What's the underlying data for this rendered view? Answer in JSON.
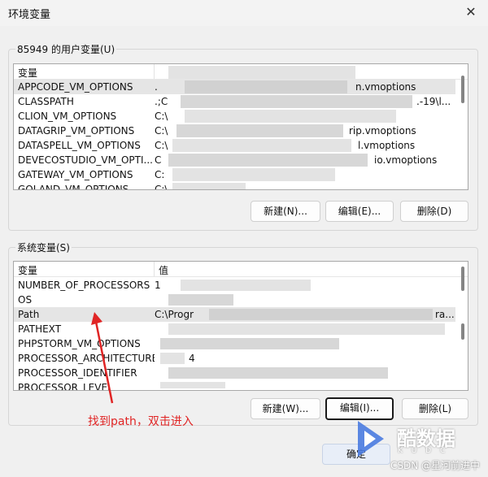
{
  "window": {
    "title": "环境变量",
    "close_glyph": "✕"
  },
  "user_group": {
    "label": "85949 的用户变量(U)",
    "column_name": "变量",
    "column_value": "",
    "rows": [
      {
        "name": "APPCODE_VM_OPTIONS",
        "value": ".",
        "value_end": "n.vmoptions"
      },
      {
        "name": "CLASSPATH",
        "value": ".;C",
        "value_end": ".-19\\l..."
      },
      {
        "name": "CLION_VM_OPTIONS",
        "value": "C:\\",
        "value_end": ""
      },
      {
        "name": "DATAGRIP_VM_OPTIONS",
        "value": "C:\\",
        "value_end": "rip.vmoptions"
      },
      {
        "name": "DATASPELL_VM_OPTIONS",
        "value": "C:\\",
        "value_end": "l.vmoptions"
      },
      {
        "name": "DEVECOSTUDIO_VM_OPTI...",
        "value": "C",
        "value_end": "io.vmoptions"
      },
      {
        "name": "GATEWAY_VM_OPTIONS",
        "value": "C:",
        "value_end": ""
      },
      {
        "name": "GOLAND_VM_OPTIONS",
        "value": "C:\\",
        "value_end": ""
      }
    ],
    "buttons": {
      "new": "新建(N)...",
      "edit": "编辑(E)...",
      "delete": "删除(D)"
    }
  },
  "system_group": {
    "label": "系统变量(S)",
    "column_name": "变量",
    "column_value": "值",
    "rows": [
      {
        "name": "NUMBER_OF_PROCESSORS",
        "value": "1",
        "value_end": ""
      },
      {
        "name": "OS",
        "value": "",
        "value_end": ""
      },
      {
        "name": "Path",
        "value": "C:\\Progr",
        "value_end": "ra..."
      },
      {
        "name": "PATHEXT",
        "value": "",
        "value_end": ""
      },
      {
        "name": "PHPSTORM_VM_OPTIONS",
        "value": "",
        "value_end": ""
      },
      {
        "name": "PROCESSOR_ARCHITECTURE",
        "value": "4",
        "value_end": ""
      },
      {
        "name": "PROCESSOR_IDENTIFIER",
        "value": "",
        "value_end": ""
      },
      {
        "name": "PROCESSOR_LEVEL",
        "value": "",
        "value_end": ""
      }
    ],
    "buttons": {
      "new": "新建(W)...",
      "edit": "编辑(I)...",
      "delete": "删除(L)"
    }
  },
  "footer": {
    "ok": "确定"
  },
  "annotation": {
    "text": "找到path，双击进入",
    "color": "#e02525"
  },
  "watermark": {
    "brand": "酷数据",
    "sub": "K U  D  C",
    "csdn": "CSDN @星河前进中"
  },
  "colors": {
    "accent": "#e02525",
    "selection": "#e5e5e5",
    "logo": "#4a7be0"
  }
}
